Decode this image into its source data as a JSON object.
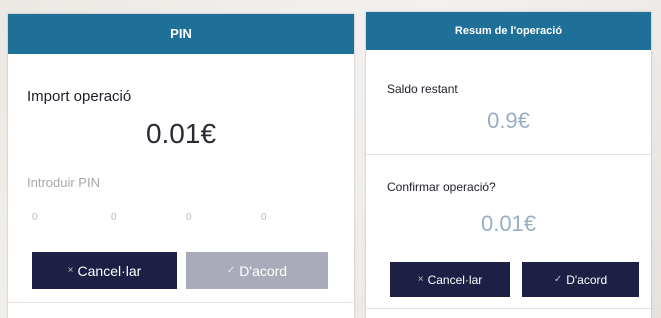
{
  "pin_dialog": {
    "title": "PIN",
    "amount_label": "Import operació",
    "amount": "0.01€",
    "pin_label": "Introduir PIN",
    "pin_digits": [
      "0",
      "0",
      "0",
      "0"
    ],
    "cancel_label": "Cancel·lar",
    "ok_label": "D'acord",
    "cancel_icon": "x-icon",
    "ok_icon": "check-icon"
  },
  "summary_dialog": {
    "title": "Resum de l'operació",
    "balance_label": "Saldo restant",
    "balance": "0.9€",
    "confirm_label": "Confirmar operació?",
    "confirm_amount": "0.01€",
    "cancel_label": "Cancel·lar",
    "ok_label": "D'acord",
    "cancel_icon": "x-icon",
    "ok_icon": "check-icon"
  },
  "colors": {
    "header": "#1f7098",
    "button_primary": "#1d1f45",
    "button_disabled": "#a9abbb",
    "amount_muted": "#9aaec3"
  }
}
